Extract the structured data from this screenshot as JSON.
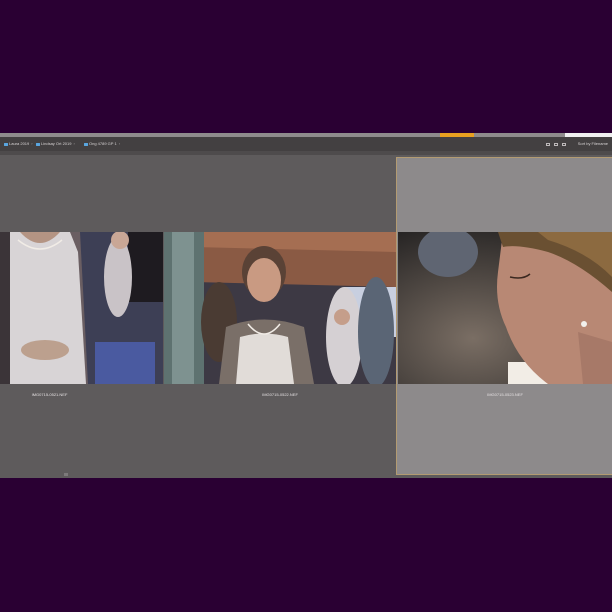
{
  "breadcrumbs": [
    {
      "label": "Laura 2019"
    },
    {
      "label": "Lindsay Ort 2019"
    },
    {
      "label": "Ong 4789 GP 1"
    }
  ],
  "toolbar": {
    "sort_label": "Sort by Filename"
  },
  "thumbnails": [
    {
      "caption": "IMG0715-0521.NEF",
      "selected": false
    },
    {
      "caption": "IMG0715-0522.NEF",
      "selected": false
    },
    {
      "caption": "IMG0715-0523.NEF",
      "selected": true
    }
  ],
  "colors": {
    "background": "#2a0033",
    "accent": "#e8a020",
    "selection": "#8d8a8b"
  }
}
